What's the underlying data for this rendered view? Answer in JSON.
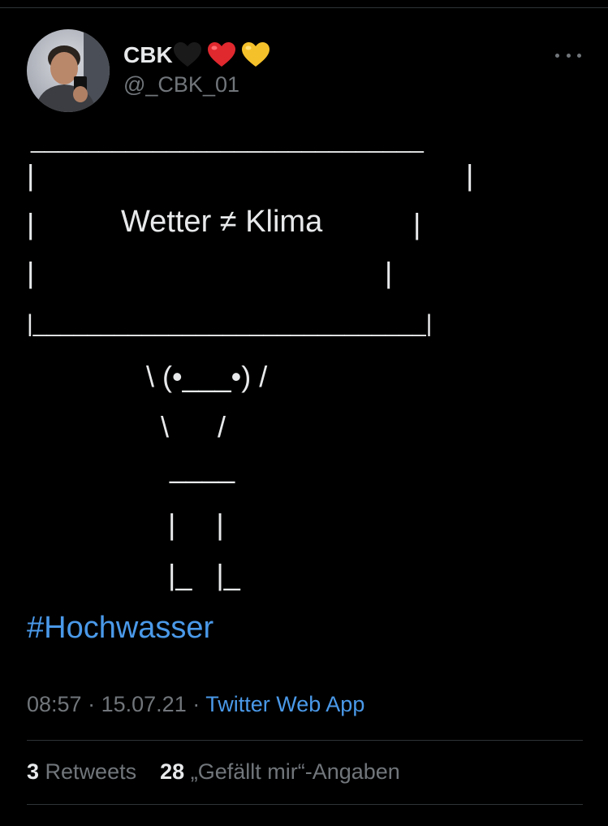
{
  "tweet": {
    "author": {
      "display_name": "CBK",
      "name_emojis": [
        "black-heart",
        "red-heart",
        "yellow-heart"
      ],
      "handle": "@_CBK_01"
    },
    "body": {
      "ascii_sign": {
        "top_border": "_____________________________",
        "row1_left": "|",
        "row1_right": "|",
        "message": "Wetter ≠ Klima",
        "row2_left": "|",
        "row2_right": "|",
        "row3_left": "|",
        "row3_right": "|",
        "bottom_border": "|_____________________________|"
      },
      "ascii_figure": {
        "arms_face": "\\ (•___•) /",
        "body": "\\      /",
        "waist": "____",
        "legs": "|     |",
        "feet": "|_   |_"
      },
      "hashtag": "#Hochwasser"
    },
    "meta": {
      "time": "08:57",
      "separator": "·",
      "date": "15.07.21",
      "source": "Twitter Web App"
    },
    "stats": {
      "retweets_count": "3",
      "retweets_label": "Retweets",
      "likes_count": "28",
      "likes_label": "„Gefällt mir“-Angaben"
    }
  },
  "colors": {
    "background": "#000000",
    "text_primary": "#e7e9ea",
    "text_secondary": "#71767b",
    "link": "#4a99e9",
    "divider": "#2f3336"
  },
  "icons": {
    "more": "more-horizontal-icon"
  }
}
